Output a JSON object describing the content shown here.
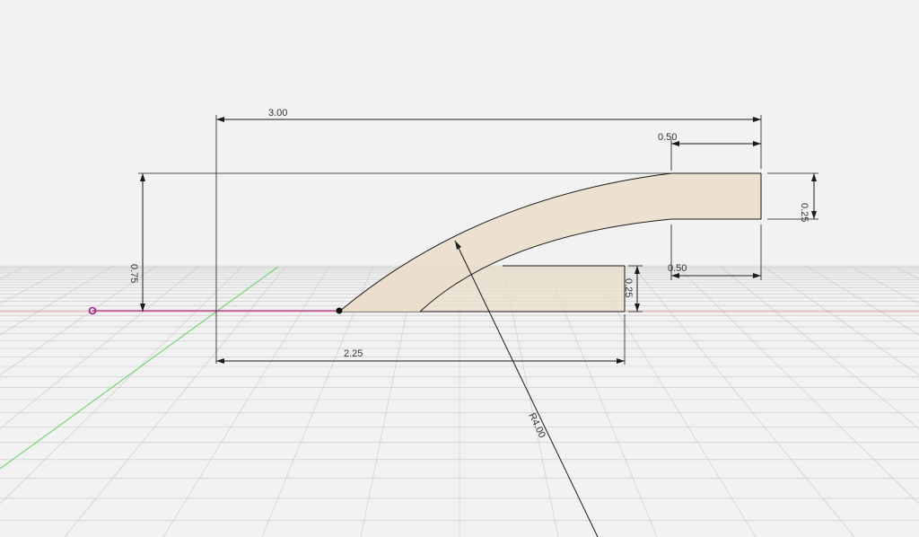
{
  "colors": {
    "background": "#f2f2f2",
    "grid": "#c8c8c8",
    "profile_fill": "#ebddcb",
    "x_axis": "#e05a5a",
    "y_axis": "#62d062",
    "origin_line": "#a0218f",
    "stroke": "#1a1a1a"
  },
  "dimensions": {
    "overall_length": "3.00",
    "top_offset": "0.50",
    "right_thickness": "0.25",
    "bottom_offset": "0.50",
    "base_thickness": "0.25",
    "base_length": "2.25",
    "height": "0.75",
    "radius": "R4.00"
  },
  "icons": {
    "origin": "origin-point-icon",
    "sketch_point": "sketch-point-icon"
  }
}
